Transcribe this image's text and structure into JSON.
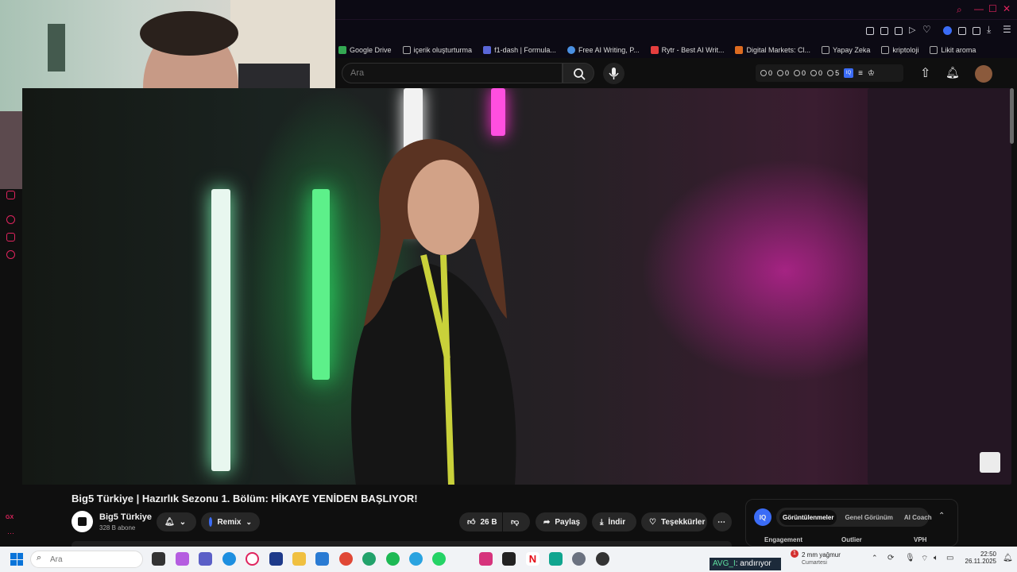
{
  "bookmarks": [
    {
      "label": "Google Drive",
      "color": "#34a853"
    },
    {
      "label": "içerik oluşturturma",
      "color": "#888888"
    },
    {
      "label": "f1-dash | Formula...",
      "color": "#5a67d8"
    },
    {
      "label": "Free AI Writing, P...",
      "color": "#4a90e2"
    },
    {
      "label": "Rytr - Best AI Writ...",
      "color": "#e53e3e"
    },
    {
      "label": "Digital Markets: Cl...",
      "color": "#dd6b20"
    },
    {
      "label": "Yapay Zeka",
      "color": "#888888"
    },
    {
      "label": "kriptoloji",
      "color": "#888888"
    },
    {
      "label": "Likit aroma",
      "color": "#888888"
    }
  ],
  "search": {
    "placeholder": "Ara"
  },
  "stats": [
    {
      "icon": "clock-icon",
      "value": "0"
    },
    {
      "icon": "eye-icon",
      "value": "0"
    },
    {
      "icon": "view-icon",
      "value": "0"
    },
    {
      "icon": "tag-icon",
      "value": "0"
    },
    {
      "icon": "user-icon",
      "value": "5"
    }
  ],
  "video": {
    "title": "Big5 Türkiye | Hazırlık Sezonu 1. Bölüm: HİKAYE YENİDEN BAŞLIYOR!",
    "channel_name": "Big5 Türkiye",
    "channel_subs": "328 B abone"
  },
  "actions": {
    "remix": "Remix",
    "likes": "26 B",
    "share": "Paylaş",
    "download": "İndir",
    "thanks": "Teşekkürler"
  },
  "iq_panel": {
    "badge": "IQ",
    "tabs": [
      "Görüntülenmeler",
      "Genel Görünüm",
      "AI Coach"
    ],
    "columns": [
      "Engagement",
      "Outlier",
      "VPH"
    ]
  },
  "taskbar": {
    "search_placeholder": "Ara",
    "ticker_prefix": "AVG_I",
    "ticker_text": ": andırıyor",
    "weather_title": "2 mm yağmur",
    "weather_day": "Cumartesi",
    "weather_badge": "1",
    "time": "22:50",
    "date": "26.11.2025"
  },
  "colors": {
    "accent": "#e0245e",
    "iq_blue": "#3b6cf6"
  }
}
